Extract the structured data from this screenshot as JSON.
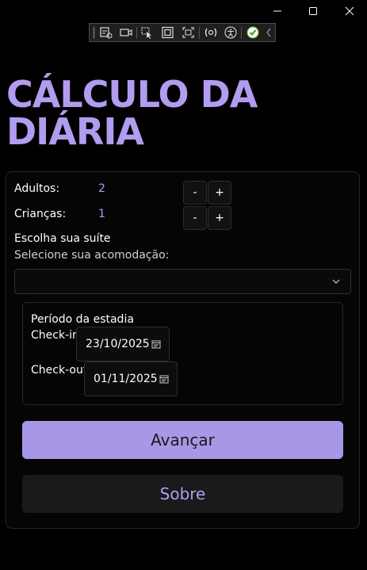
{
  "window": {
    "minimize_icon": "minimize-icon",
    "maximize_icon": "maximize-icon",
    "close_icon": "close-icon"
  },
  "dev_toolbar": {
    "icons": [
      "live-visual-tree-icon",
      "video-icon",
      "select-element-icon",
      "display-layout-adorners-icon",
      "track-focus-icon",
      "hot-reload-icon",
      "accessibility-icon",
      "checkmark-icon",
      "collapse-chevron-icon"
    ]
  },
  "title": "CÁLCULO DA DIÁRIA",
  "guests": {
    "adults_label": "Adultos:",
    "adults_value": "2",
    "children_label": "Crianças:",
    "children_value": "1",
    "minus_label": "-",
    "plus_label": "+"
  },
  "suite": {
    "heading": "Escolha sua suíte",
    "placeholder": "Selecione sua acomodação:",
    "selected": ""
  },
  "period": {
    "heading": "Período da estadia",
    "checkin_label": "Check-in",
    "checkin_value": "23/10/2025",
    "checkout_label": "Check-out",
    "checkout_value": "01/11/2025"
  },
  "actions": {
    "advance_label": "Avançar",
    "about_label": "Sobre"
  },
  "colors": {
    "accent": "#b19cf0",
    "primary_button": "#a897e6",
    "background": "#000000",
    "secondary_button": "#1a1a1a"
  }
}
